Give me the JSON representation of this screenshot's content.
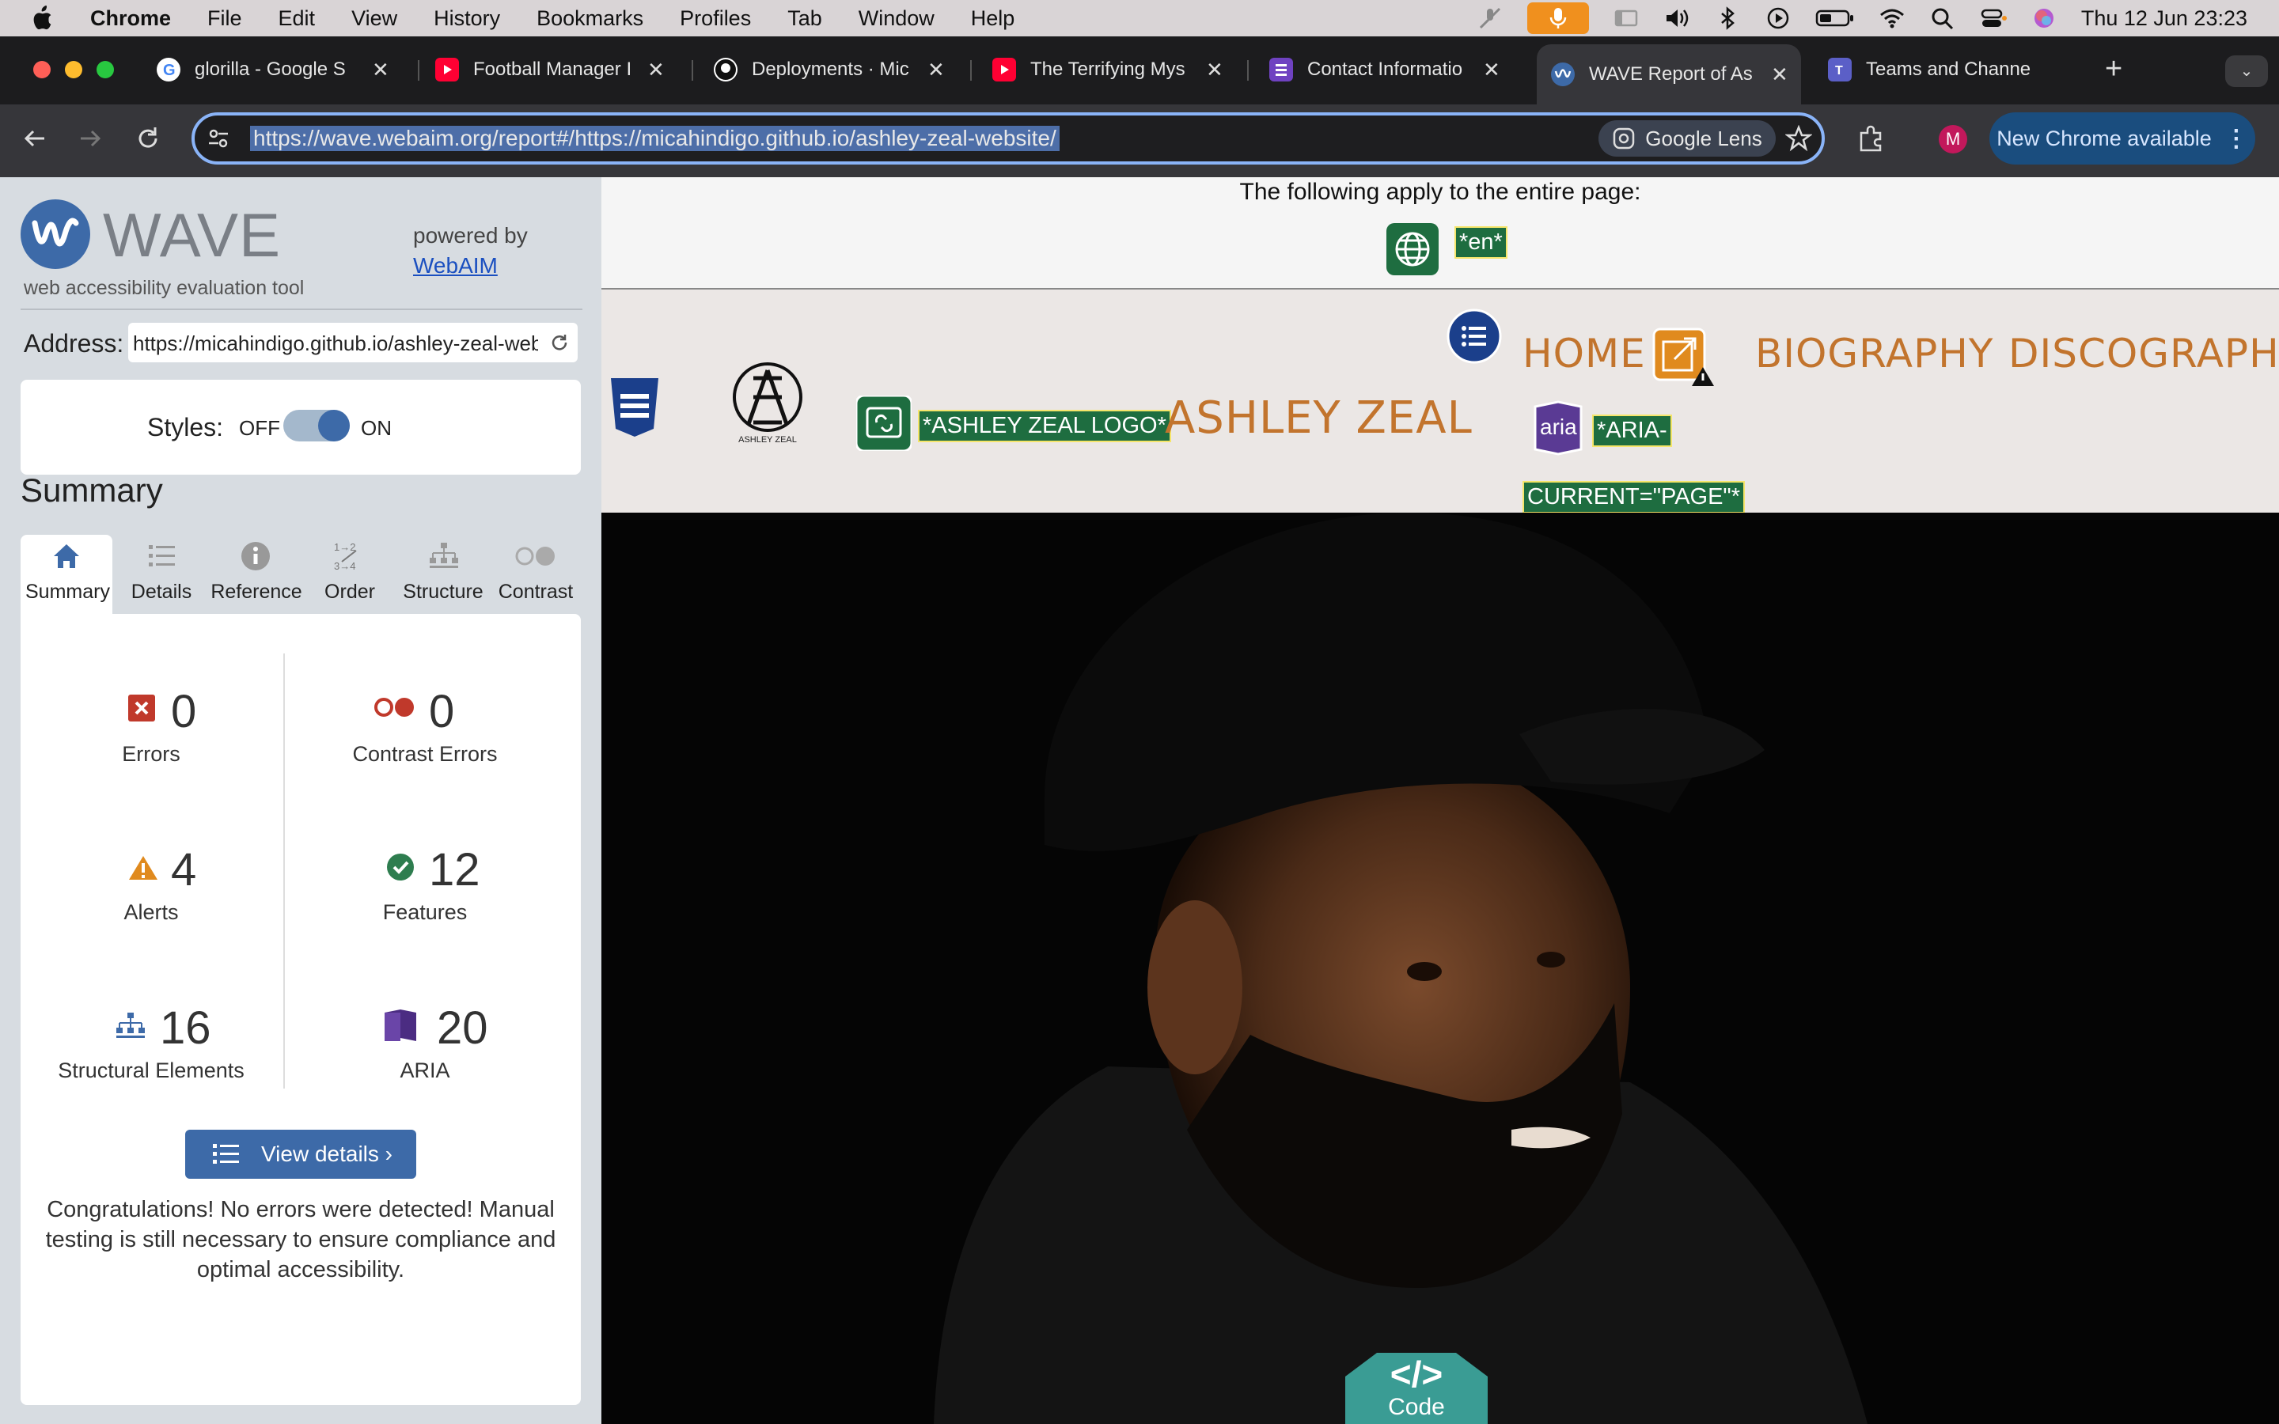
{
  "menubar": {
    "app": "Chrome",
    "items": [
      "File",
      "Edit",
      "View",
      "History",
      "Bookmarks",
      "Profiles",
      "Tab",
      "Window",
      "Help"
    ],
    "clock": "Thu 12 Jun  23:23"
  },
  "tabs": [
    {
      "title": "glorilla - Google S",
      "icon": "google-icon"
    },
    {
      "title": "Football Manager I",
      "icon": "youtube-icon"
    },
    {
      "title": "Deployments · Mic",
      "icon": "github-icon"
    },
    {
      "title": "The Terrifying Mys",
      "icon": "youtube-icon"
    },
    {
      "title": "Contact Informatio",
      "icon": "forms-icon"
    },
    {
      "title": "WAVE Report of As",
      "icon": "wave-icon",
      "active": true
    },
    {
      "title": "Teams and Channe",
      "icon": "teams-icon"
    }
  ],
  "toolbar": {
    "url": "https://wave.webaim.org/report#/https://micahindigo.github.io/ashley-zeal-website/",
    "lens_label": "Google Lens",
    "profile_initial": "M",
    "new_chrome_label": "New Chrome available"
  },
  "wave": {
    "logo_text": "WAVE",
    "tagline": "web accessibility evaluation tool",
    "powered_by": "powered by",
    "webaim_link": "WebAIM",
    "address_label": "Address:",
    "address_value": "https://micahindigo.github.io/ashley-zeal-website/",
    "styles_label": "Styles:",
    "styles_off": "OFF",
    "styles_on": "ON",
    "summary_heading": "Summary",
    "tabs": [
      "Summary",
      "Details",
      "Reference",
      "Order",
      "Structure",
      "Contrast"
    ],
    "stats": {
      "errors": {
        "value": "0",
        "label": "Errors"
      },
      "contrast": {
        "value": "0",
        "label": "Contrast Errors"
      },
      "alerts": {
        "value": "4",
        "label": "Alerts"
      },
      "features": {
        "value": "12",
        "label": "Features"
      },
      "structural": {
        "value": "16",
        "label": "Structural Elements"
      },
      "aria": {
        "value": "20",
        "label": "ARIA"
      }
    },
    "view_details": "View details ›",
    "congrats": "Congratulations! No errors were detected! Manual testing is still necessary to ensure compliance and optimal accessibility."
  },
  "page": {
    "entire_page_note": "The following apply to the entire page:",
    "lang_label": "*en*",
    "logo_alt_label": "*ASHLEY ZEAL LOGO*",
    "site_name": "ASHLEY ZEAL",
    "logo_caption": "ASHLEY ZEAL",
    "nav": [
      "HOME",
      "BIOGRAPHY",
      "DISCOGRAPHY"
    ],
    "aria_icon_text": "aria",
    "aria_label_1": "*ARIA-",
    "aria_label_2": "CURRENT=\"PAGE\"*",
    "code_button": "Code",
    "code_glyph": "</>"
  },
  "colors": {
    "wave_blue": "#3d6aa8",
    "error_red": "#c0392b",
    "alert_orange": "#e08a1e",
    "feature_green": "#2e7d4f",
    "aria_purple": "#4b2c82",
    "nav_brown": "#c2742d",
    "label_green": "#1e6d40"
  }
}
